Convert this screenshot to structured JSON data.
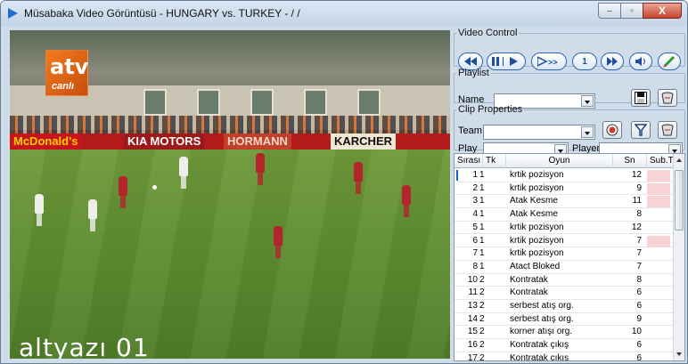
{
  "window": {
    "title": "Müsabaka Video Görüntüsü - HUNGARY vs. TURKEY -  / /",
    "minimize": "–",
    "maximize": "▫",
    "close": "X"
  },
  "video": {
    "logo_main": "atv",
    "logo_sub": "canlı",
    "caption": "altyazı 01",
    "boards": [
      "McDonald's",
      "KIA MOTORS",
      "HORMANN",
      "KARCHER"
    ]
  },
  "video_control": {
    "legend": "Video Control",
    "buttons": [
      "rewind",
      "pause-play",
      "play",
      "fast-forward",
      "1",
      "step-forward",
      "audio",
      "edit"
    ],
    "step_label": "1"
  },
  "playlist": {
    "legend": "Playlist",
    "name_label": "Name",
    "name_value": ""
  },
  "clip_properties": {
    "legend": "Clip Properties",
    "team_label": "Team",
    "team_value": "",
    "play_label": "Play",
    "play_value": "",
    "player_label": "Player",
    "player_value": ""
  },
  "table": {
    "columns": [
      "Sırası",
      "Tk",
      "Oyun",
      "Sn",
      "Sub.T."
    ],
    "rows": [
      {
        "sira": "1",
        "tk": "1",
        "oyun": "krtik pozisyon",
        "sn": "12",
        "pink": true
      },
      {
        "sira": "2",
        "tk": "1",
        "oyun": "krtik pozisyon",
        "sn": "9",
        "pink": true
      },
      {
        "sira": "3",
        "tk": "1",
        "oyun": "Atak Kesme",
        "sn": "11",
        "pink": true
      },
      {
        "sira": "4",
        "tk": "1",
        "oyun": "Atak Kesme",
        "sn": "8",
        "pink": false
      },
      {
        "sira": "5",
        "tk": "1",
        "oyun": "krtik pozisyon",
        "sn": "12",
        "pink": false
      },
      {
        "sira": "6",
        "tk": "1",
        "oyun": "krtik pozisyon",
        "sn": "7",
        "pink": true
      },
      {
        "sira": "7",
        "tk": "1",
        "oyun": "krtik pozisyon",
        "sn": "7",
        "pink": false
      },
      {
        "sira": "8",
        "tk": "1",
        "oyun": "Atact Bloked",
        "sn": "7",
        "pink": false
      },
      {
        "sira": "10",
        "tk": "2",
        "oyun": "Kontratak",
        "sn": "8",
        "pink": false
      },
      {
        "sira": "11",
        "tk": "2",
        "oyun": "Kontratak",
        "sn": "6",
        "pink": false
      },
      {
        "sira": "13",
        "tk": "2",
        "oyun": "serbest atış org.",
        "sn": "6",
        "pink": false
      },
      {
        "sira": "14",
        "tk": "2",
        "oyun": "serbest atış org.",
        "sn": "9",
        "pink": false
      },
      {
        "sira": "15",
        "tk": "2",
        "oyun": "korner atışı org.",
        "sn": "10",
        "pink": false
      },
      {
        "sira": "16",
        "tk": "2",
        "oyun": "Kontratak çıkış",
        "sn": "6",
        "pink": false
      },
      {
        "sira": "17",
        "tk": "2",
        "oyun": "Kontratak çıkış",
        "sn": "6",
        "pink": false
      }
    ]
  },
  "colors": {
    "accent": "#1e5fc9",
    "pink_cell": "#f7d3d5",
    "window_bg": "#cfdce9"
  }
}
